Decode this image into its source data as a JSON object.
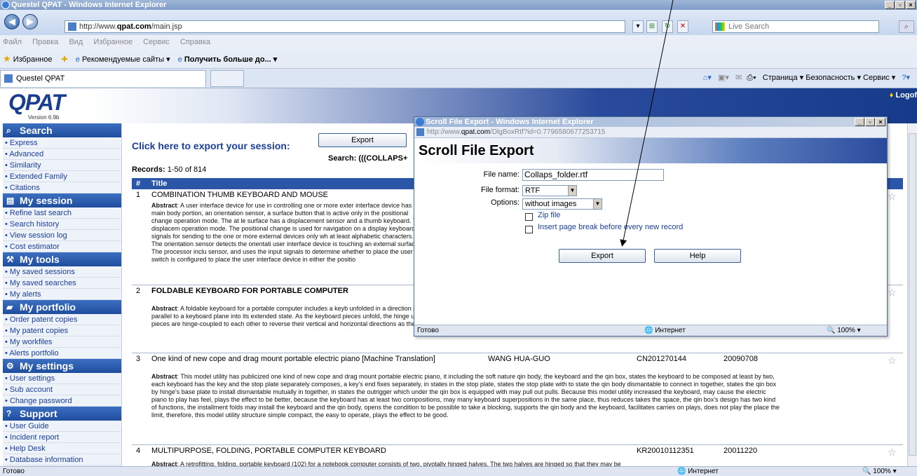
{
  "browser": {
    "title": "Questel QPAT - Windows Internet Explorer",
    "url_prefix": "http://www.",
    "url_domain": "qpat.com",
    "url_path": "/main.jsp",
    "live_search_placeholder": "Live Search",
    "menu": [
      "Файл",
      "Правка",
      "Вид",
      "Избранное",
      "Сервис",
      "Справка"
    ],
    "favorites_label": "Избранное",
    "fav_links": [
      "Рекомендуемые сайты ▾",
      "Получить больше до... ▾"
    ],
    "tab_title": "Questel QPAT",
    "commands": "Страница ▾  Безопасность ▾  Сервис ▾",
    "status_text": "Готово",
    "zone": "Интернет",
    "zoom": "100%"
  },
  "header": {
    "logo": "QPAT",
    "version": "Version 6.9b",
    "logoff": "Logof"
  },
  "sidebar": {
    "sections": [
      {
        "title": "Search",
        "icon": "search-icon",
        "items": [
          "Express",
          "Advanced",
          "Similarity",
          "Extended Family",
          "Citations"
        ]
      },
      {
        "title": "My session",
        "icon": "session-icon",
        "items": [
          "Refine last search",
          "Search history",
          "View session log",
          "Cost estimator"
        ]
      },
      {
        "title": "My tools",
        "icon": "tools-icon",
        "items": [
          "My saved sessions",
          "My saved searches",
          "My alerts"
        ]
      },
      {
        "title": "My portfolio",
        "icon": "folder-icon",
        "items": [
          "Order patent copies",
          "My patent copies",
          "My workfiles",
          "Alerts portfolio"
        ]
      },
      {
        "title": "My settings",
        "icon": "settings-icon",
        "items": [
          "User settings",
          "Sub account",
          "Change password"
        ]
      },
      {
        "title": "Support",
        "icon": "support-icon",
        "items": [
          "User Guide",
          "Incident report",
          "Help Desk",
          "Database information"
        ]
      }
    ]
  },
  "main": {
    "export_heading": "Click here to export your session:",
    "export_button": "Export",
    "search_label": "Search:",
    "search_query": "(((COLLAPS+",
    "records_label": "Records:",
    "records_value": "1-50 of 814",
    "columns": [
      "#",
      "Title"
    ],
    "rows": [
      {
        "num": "1",
        "title": "COMBINATION THUMB KEYBOARD AND MOUSE",
        "inventor": "",
        "patent": "",
        "date": "",
        "abstract_label": "Abstract",
        "abstract": ": A user interface device for use in controlling one or more exter interface device has a main body portion, an orientation sensor, a surface button that is active only in the positional change operation mode. The at le surface has a displacement sensor and a thumb keyboard. The displacem operation mode. The positional change is used for navigation on a display keyboard signals for sending to the one or more external devices only wh at least alphabetic characters. The orientation sensor detects the orientati user interface device is touching an external surface. The processor inclu sensor, and uses the input signals to determine whether to place the user switch is configured to place the user interface device in either the positio"
      },
      {
        "num": "2",
        "title": "FOLDABLE KEYBOARD FOR PORTABLE COMPUTER",
        "inventor": "",
        "patent": "",
        "date": "",
        "abstract_label": "Abstract",
        "abstract": ": A foldable keyboard for a portable computer includes a keyb unfolded in a direction parallel to a keyboard plane. Another embodiment o along its length; and a keyboard body which comprises two keyboard piec parallel to a keyboard plane into its extended state. As the keyboard pieces unfold, the hinge unit slides along the long hole as the keyboard edges, which are facing each other, are stuck together. Thus, the two keyboard pieces are hinge-coupled to each other to reverse their vertical and horizontal directions as the keyboard body is extended."
      },
      {
        "num": "3",
        "title": "One kind of new cope and drag mount portable electric piano [Machine Translation]",
        "inventor": "WANG HUA-GUO",
        "patent": "CN201270144",
        "date": "20090708",
        "abstract_label": "Abstract",
        "abstract": ": This model utility has publicized one kind of new cope and drag mount portable electric piano, it including the soft nature qin body, the keyboard and the qin box, states the keyboard to be composed at least by two, each keyboard has the key and the stop plate separately composes, a key's end fixes separately, in states in the stop plate, states the stop plate with to state the qin body dismantable to connect in together, states the qin box by hinge's base plate to install dismantable mutually in together, in states the outrigger which under the qin box is equipped with may pull out pulls. Because this model utility increased the keyboard, may cause the electric piano to play has feel, plays the effect to be better, because the keyboard has at least two compositions, may many keyboard superpositions in the same place, thus reduces takes the space, the qin box's design has two kind of functions, the installment folds may install the keyboard and the qin body, opens the condition to be possible to take a blocking, supports the qin body and the keyboard, facilitates carries on plays, does not play the place the limit, therefore, this model utility structure simple compact, the easy to operate, plays the effect to be good."
      },
      {
        "num": "4",
        "title": "MULTIPURPOSE, FOLDING, PORTABLE COMPUTER KEYBOARD",
        "inventor": "",
        "patent": "KR20010112351",
        "date": "20011220",
        "abstract_label": "Abstract",
        "abstract": ": A retrofitting, folding, portable keyboard (102) for a notebook computer consists of two, pivotally hinged halves. The two halves are hinged so that they may be"
      }
    ]
  },
  "dialog": {
    "title": "Scroll File Export - Windows Internet Explorer",
    "url_prefix": "http://www.",
    "url_domain": "qpat.com",
    "url_path": "/DlgBoxRtf?id=0.7796580677253715",
    "heading": "Scroll File Export",
    "file_name_label": "File name:",
    "file_name_value": "Collaps_folder.rtf",
    "file_format_label": "File format:",
    "file_format_value": "RTF",
    "options_label": "Options:",
    "options_value": "without images",
    "zip_label": "Zip file",
    "page_break_label": "Insert page break before every new record",
    "export_button": "Export",
    "help_button": "Help",
    "status_text": "Готово",
    "zone": "Интернет",
    "zoom": "100%"
  }
}
